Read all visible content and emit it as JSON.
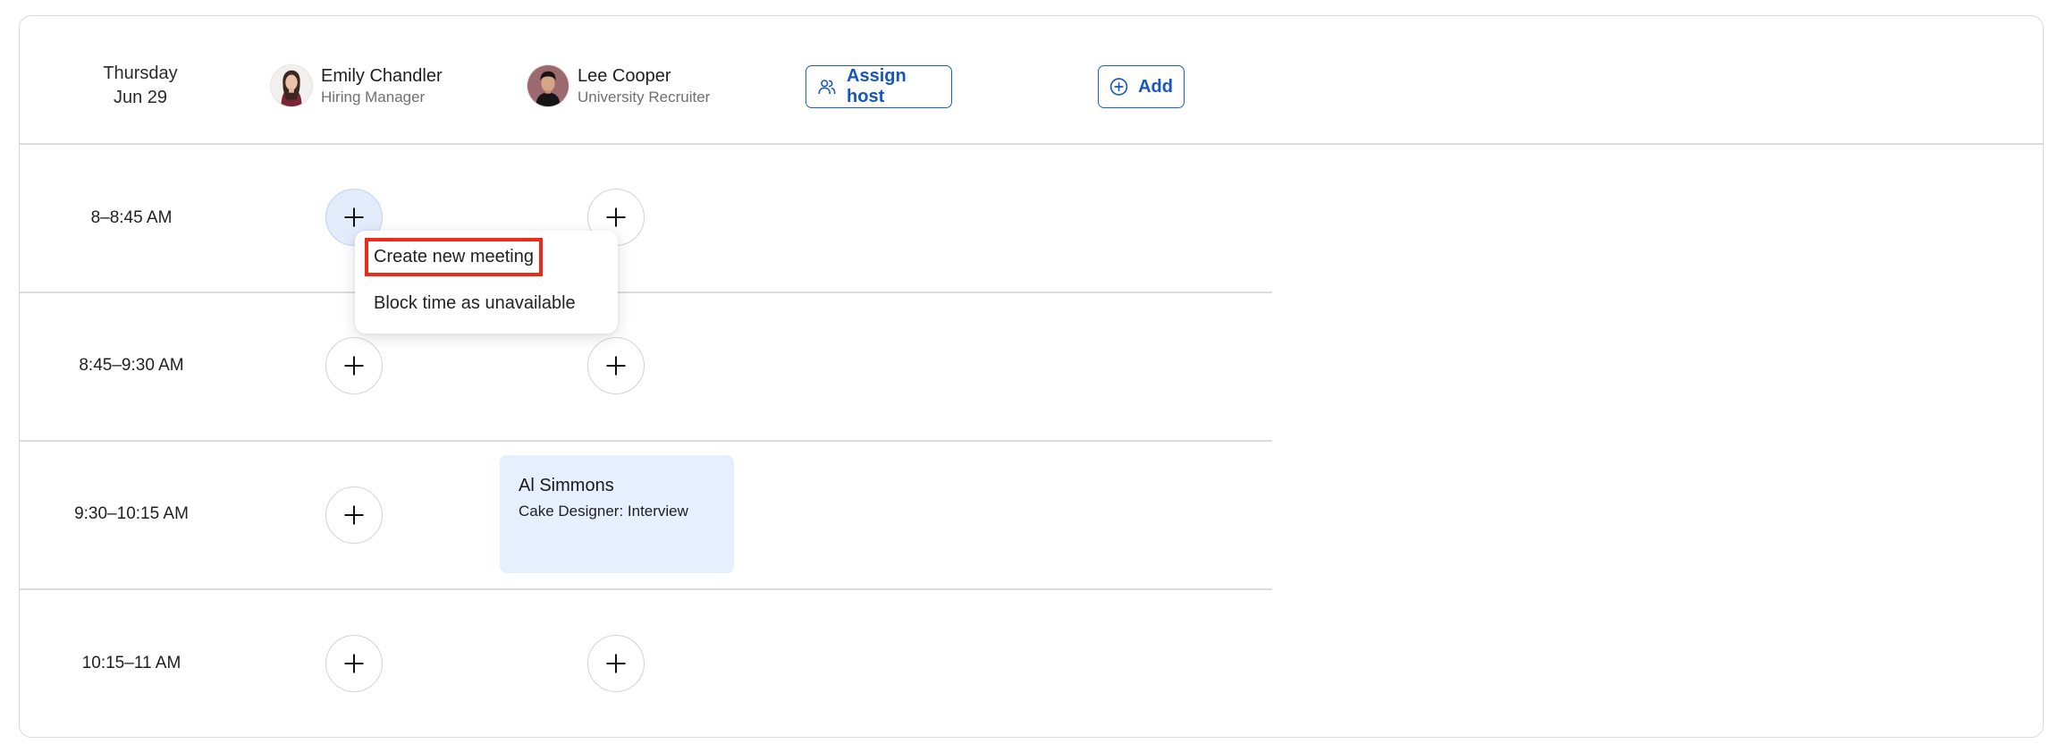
{
  "header": {
    "day": "Thursday",
    "date": "Jun 29",
    "hosts": [
      {
        "name": "Emily Chandler",
        "role": "Hiring Manager"
      },
      {
        "name": "Lee Cooper",
        "role": "University Recruiter"
      }
    ],
    "assign_host_label": "Assign host",
    "add_label": "Add"
  },
  "time_slots": [
    {
      "label": "8–8:45 AM"
    },
    {
      "label": "8:45–9:30 AM"
    },
    {
      "label": "9:30–10:15 AM"
    },
    {
      "label": "10:15–11 AM"
    }
  ],
  "context_menu": {
    "items": [
      {
        "label": "Create new meeting"
      },
      {
        "label": "Block time as unavailable"
      }
    ]
  },
  "meeting": {
    "name": "Al Simmons",
    "description": "Cake Designer: Interview"
  },
  "colors": {
    "accent": "#1556c2",
    "meeting_bg": "#e6effd",
    "highlight_box": "#ee2b17"
  },
  "icons": {
    "assign_host": "users-icon",
    "add": "plus-circle-icon",
    "slot": "plus-icon"
  }
}
